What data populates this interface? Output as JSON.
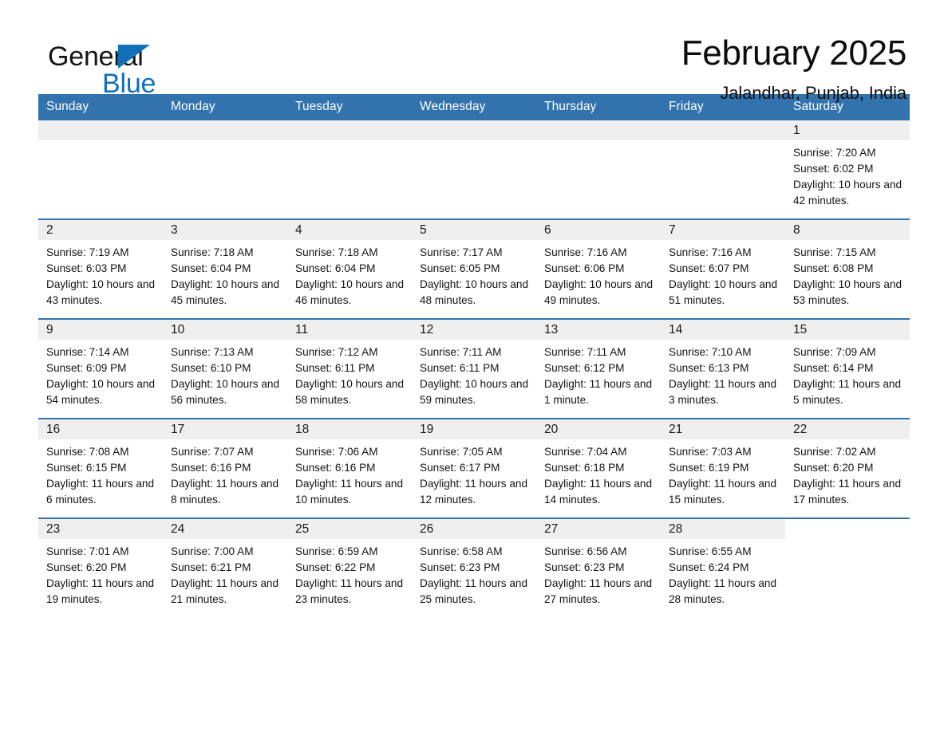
{
  "brand": {
    "name_part1": "General",
    "name_part2": "Blue",
    "accent_color": "#1270b8"
  },
  "header": {
    "title": "February 2025",
    "location": "Jalandhar, Punjab, India"
  },
  "calendar": {
    "header_bg": "#3273ad",
    "daynum_band_bg": "#efefef",
    "weekday_headers": [
      "Sunday",
      "Monday",
      "Tuesday",
      "Wednesday",
      "Thursday",
      "Friday",
      "Saturday"
    ],
    "weeks": [
      [
        {
          "day": "",
          "empty": true
        },
        {
          "day": "",
          "empty": true
        },
        {
          "day": "",
          "empty": true
        },
        {
          "day": "",
          "empty": true
        },
        {
          "day": "",
          "empty": true
        },
        {
          "day": "",
          "empty": true
        },
        {
          "day": "1",
          "sunrise": "Sunrise: 7:20 AM",
          "sunset": "Sunset: 6:02 PM",
          "daylight": "Daylight: 10 hours and 42 minutes."
        }
      ],
      [
        {
          "day": "2",
          "sunrise": "Sunrise: 7:19 AM",
          "sunset": "Sunset: 6:03 PM",
          "daylight": "Daylight: 10 hours and 43 minutes."
        },
        {
          "day": "3",
          "sunrise": "Sunrise: 7:18 AM",
          "sunset": "Sunset: 6:04 PM",
          "daylight": "Daylight: 10 hours and 45 minutes."
        },
        {
          "day": "4",
          "sunrise": "Sunrise: 7:18 AM",
          "sunset": "Sunset: 6:04 PM",
          "daylight": "Daylight: 10 hours and 46 minutes."
        },
        {
          "day": "5",
          "sunrise": "Sunrise: 7:17 AM",
          "sunset": "Sunset: 6:05 PM",
          "daylight": "Daylight: 10 hours and 48 minutes."
        },
        {
          "day": "6",
          "sunrise": "Sunrise: 7:16 AM",
          "sunset": "Sunset: 6:06 PM",
          "daylight": "Daylight: 10 hours and 49 minutes."
        },
        {
          "day": "7",
          "sunrise": "Sunrise: 7:16 AM",
          "sunset": "Sunset: 6:07 PM",
          "daylight": "Daylight: 10 hours and 51 minutes."
        },
        {
          "day": "8",
          "sunrise": "Sunrise: 7:15 AM",
          "sunset": "Sunset: 6:08 PM",
          "daylight": "Daylight: 10 hours and 53 minutes."
        }
      ],
      [
        {
          "day": "9",
          "sunrise": "Sunrise: 7:14 AM",
          "sunset": "Sunset: 6:09 PM",
          "daylight": "Daylight: 10 hours and 54 minutes."
        },
        {
          "day": "10",
          "sunrise": "Sunrise: 7:13 AM",
          "sunset": "Sunset: 6:10 PM",
          "daylight": "Daylight: 10 hours and 56 minutes."
        },
        {
          "day": "11",
          "sunrise": "Sunrise: 7:12 AM",
          "sunset": "Sunset: 6:11 PM",
          "daylight": "Daylight: 10 hours and 58 minutes."
        },
        {
          "day": "12",
          "sunrise": "Sunrise: 7:11 AM",
          "sunset": "Sunset: 6:11 PM",
          "daylight": "Daylight: 10 hours and 59 minutes."
        },
        {
          "day": "13",
          "sunrise": "Sunrise: 7:11 AM",
          "sunset": "Sunset: 6:12 PM",
          "daylight": "Daylight: 11 hours and 1 minute."
        },
        {
          "day": "14",
          "sunrise": "Sunrise: 7:10 AM",
          "sunset": "Sunset: 6:13 PM",
          "daylight": "Daylight: 11 hours and 3 minutes."
        },
        {
          "day": "15",
          "sunrise": "Sunrise: 7:09 AM",
          "sunset": "Sunset: 6:14 PM",
          "daylight": "Daylight: 11 hours and 5 minutes."
        }
      ],
      [
        {
          "day": "16",
          "sunrise": "Sunrise: 7:08 AM",
          "sunset": "Sunset: 6:15 PM",
          "daylight": "Daylight: 11 hours and 6 minutes."
        },
        {
          "day": "17",
          "sunrise": "Sunrise: 7:07 AM",
          "sunset": "Sunset: 6:16 PM",
          "daylight": "Daylight: 11 hours and 8 minutes."
        },
        {
          "day": "18",
          "sunrise": "Sunrise: 7:06 AM",
          "sunset": "Sunset: 6:16 PM",
          "daylight": "Daylight: 11 hours and 10 minutes."
        },
        {
          "day": "19",
          "sunrise": "Sunrise: 7:05 AM",
          "sunset": "Sunset: 6:17 PM",
          "daylight": "Daylight: 11 hours and 12 minutes."
        },
        {
          "day": "20",
          "sunrise": "Sunrise: 7:04 AM",
          "sunset": "Sunset: 6:18 PM",
          "daylight": "Daylight: 11 hours and 14 minutes."
        },
        {
          "day": "21",
          "sunrise": "Sunrise: 7:03 AM",
          "sunset": "Sunset: 6:19 PM",
          "daylight": "Daylight: 11 hours and 15 minutes."
        },
        {
          "day": "22",
          "sunrise": "Sunrise: 7:02 AM",
          "sunset": "Sunset: 6:20 PM",
          "daylight": "Daylight: 11 hours and 17 minutes."
        }
      ],
      [
        {
          "day": "23",
          "sunrise": "Sunrise: 7:01 AM",
          "sunset": "Sunset: 6:20 PM",
          "daylight": "Daylight: 11 hours and 19 minutes."
        },
        {
          "day": "24",
          "sunrise": "Sunrise: 7:00 AM",
          "sunset": "Sunset: 6:21 PM",
          "daylight": "Daylight: 11 hours and 21 minutes."
        },
        {
          "day": "25",
          "sunrise": "Sunrise: 6:59 AM",
          "sunset": "Sunset: 6:22 PM",
          "daylight": "Daylight: 11 hours and 23 minutes."
        },
        {
          "day": "26",
          "sunrise": "Sunrise: 6:58 AM",
          "sunset": "Sunset: 6:23 PM",
          "daylight": "Daylight: 11 hours and 25 minutes."
        },
        {
          "day": "27",
          "sunrise": "Sunrise: 6:56 AM",
          "sunset": "Sunset: 6:23 PM",
          "daylight": "Daylight: 11 hours and 27 minutes."
        },
        {
          "day": "28",
          "sunrise": "Sunrise: 6:55 AM",
          "sunset": "Sunset: 6:24 PM",
          "daylight": "Daylight: 11 hours and 28 minutes."
        },
        {
          "day": "",
          "empty": true,
          "no_band": true
        }
      ]
    ]
  }
}
